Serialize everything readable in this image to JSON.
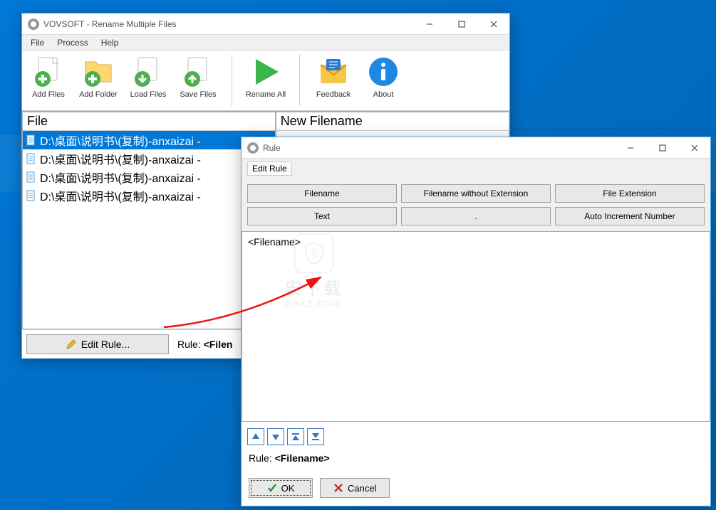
{
  "main_window": {
    "title": "VOVSOFT - Rename Multiple Files",
    "menu": [
      "File",
      "Process",
      "Help"
    ],
    "toolbar": {
      "add_files": "Add Files",
      "add_folder": "Add Folder",
      "load_files": "Load Files",
      "save_files": "Save Files",
      "rename_all": "Rename All",
      "feedback": "Feedback",
      "about": "About"
    },
    "columns": {
      "file": "File",
      "new_filename": "New Filename"
    },
    "files": [
      "D:\\桌面\\说明书\\(复制)-anxaizai -",
      "D:\\桌面\\说明书\\(复制)-anxaizai -",
      "D:\\桌面\\说明书\\(复制)-anxaizai -",
      "D:\\桌面\\说明书\\(复制)-anxaizai -"
    ],
    "edit_rule_btn": "Edit Rule...",
    "rule_prefix": "Rule:  ",
    "rule_value_prefix": "<Filen"
  },
  "rule_window": {
    "title": "Rule",
    "edit_rule_label": "Edit Rule",
    "buttons": {
      "filename": "Filename",
      "filename_no_ext": "Filename without Extension",
      "file_extension": "File Extension",
      "text": "Text",
      "dot": ".",
      "auto_increment": "Auto Increment Number"
    },
    "textarea_value": "<Filename>",
    "rule_prefix": "Rule:  ",
    "rule_value": "<Filename>",
    "ok": "OK",
    "cancel": "Cancel"
  },
  "watermark": {
    "text1": "安下载",
    "text2": "anxz.com"
  }
}
